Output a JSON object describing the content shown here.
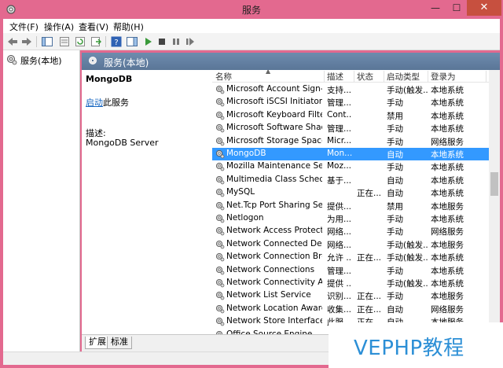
{
  "window": {
    "title": "服务",
    "minimize": "—",
    "maximize": "☐",
    "close": "✕"
  },
  "menu": [
    "文件(F)",
    "操作(A)",
    "查看(V)",
    "帮助(H)"
  ],
  "tree": {
    "label": "服务(本地)"
  },
  "pane_header": {
    "label": "服务(本地)"
  },
  "description": {
    "service_name": "MongoDB",
    "start_link": "启动",
    "start_suffix": "此服务",
    "label": "描述:",
    "value": "MongoDB Server"
  },
  "columns": {
    "name": "名称",
    "desc": "描述",
    "status": "状态",
    "start": "启动类型",
    "logon": "登录为"
  },
  "services": [
    {
      "name": "Microsoft Account Sign-i...",
      "desc": "支持...",
      "status": "",
      "start": "手动(触发...",
      "logon": "本地系统"
    },
    {
      "name": "Microsoft iSCSI Initiator ...",
      "desc": "管理...",
      "status": "",
      "start": "手动",
      "logon": "本地系统"
    },
    {
      "name": "Microsoft Keyboard Filter",
      "desc": "Cont...",
      "status": "",
      "start": "禁用",
      "logon": "本地系统"
    },
    {
      "name": "Microsoft Software Shad...",
      "desc": "管理...",
      "status": "",
      "start": "手动",
      "logon": "本地系统"
    },
    {
      "name": "Microsoft Storage Space...",
      "desc": "Micr...",
      "status": "",
      "start": "手动",
      "logon": "网络服务"
    },
    {
      "name": "MongoDB",
      "desc": "Mon...",
      "status": "",
      "start": "自动",
      "logon": "本地系统",
      "selected": true
    },
    {
      "name": "Mozilla Maintenance Ser...",
      "desc": "Moz...",
      "status": "",
      "start": "手动",
      "logon": "本地系统"
    },
    {
      "name": "Multimedia Class Schedu...",
      "desc": "基于...",
      "status": "",
      "start": "自动",
      "logon": "本地系统"
    },
    {
      "name": "MySQL",
      "desc": "",
      "status": "正在...",
      "start": "自动",
      "logon": "本地系统"
    },
    {
      "name": "Net.Tcp Port Sharing Ser...",
      "desc": "提供...",
      "status": "",
      "start": "禁用",
      "logon": "本地服务"
    },
    {
      "name": "Netlogon",
      "desc": "为用...",
      "status": "",
      "start": "手动",
      "logon": "本地系统"
    },
    {
      "name": "Network Access Protecti...",
      "desc": "网络...",
      "status": "",
      "start": "手动",
      "logon": "网络服务"
    },
    {
      "name": "Network Connected Devi...",
      "desc": "网络...",
      "status": "",
      "start": "手动(触发...",
      "logon": "本地服务"
    },
    {
      "name": "Network Connection Bro...",
      "desc": "允许 ...",
      "status": "正在...",
      "start": "手动(触发...",
      "logon": "本地系统"
    },
    {
      "name": "Network Connections",
      "desc": "管理...",
      "status": "",
      "start": "手动",
      "logon": "本地系统"
    },
    {
      "name": "Network Connectivity Ass...",
      "desc": "提供 ...",
      "status": "",
      "start": "手动(触发...",
      "logon": "本地系统"
    },
    {
      "name": "Network List Service",
      "desc": "识别...",
      "status": "正在...",
      "start": "手动",
      "logon": "本地服务"
    },
    {
      "name": "Network Location Aware...",
      "desc": "收集...",
      "status": "正在...",
      "start": "自动",
      "logon": "网络服务"
    },
    {
      "name": "Network Store Interface ...",
      "desc": "此服...",
      "status": "正在...",
      "start": "自动",
      "logon": "本地服务"
    },
    {
      "name": "Office Source Engine",
      "desc": "",
      "status": "",
      "start": "",
      "logon": ""
    }
  ],
  "tabs": {
    "expanded": "扩展",
    "standard": "标准"
  },
  "watermark": "VEPHP教程"
}
